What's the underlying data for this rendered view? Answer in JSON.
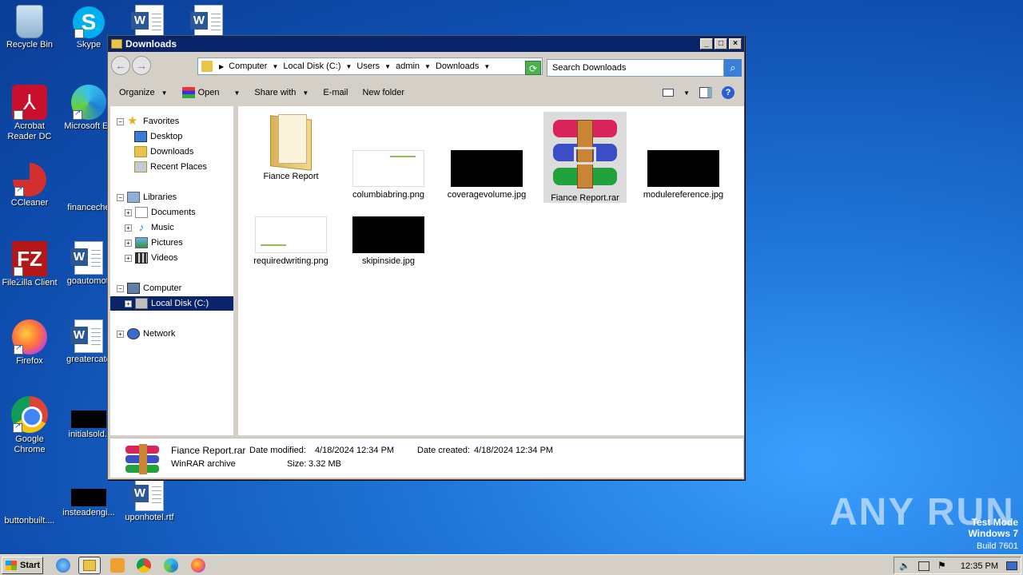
{
  "desktop": {
    "icons": [
      {
        "label": "Recycle Bin",
        "icon": "recycle-bin-icon"
      },
      {
        "label": "Skype",
        "icon": "skype-icon"
      },
      {
        "label": "Acrobat Reader DC",
        "icon": "acrobat-icon"
      },
      {
        "label": "Microsoft Ed",
        "icon": "edge-icon"
      },
      {
        "label": "CCleaner",
        "icon": "ccleaner-icon"
      },
      {
        "label": "financeche",
        "icon": "blank-file-icon"
      },
      {
        "label": "FileZilla Client",
        "icon": "filezilla-icon"
      },
      {
        "label": "goautomoti",
        "icon": "word-doc-icon"
      },
      {
        "label": "Firefox",
        "icon": "firefox-icon"
      },
      {
        "label": "greatercate",
        "icon": "word-doc-icon"
      },
      {
        "label": "Google Chrome",
        "icon": "chrome-icon"
      },
      {
        "label": "initialsold.j",
        "icon": "image-file-icon"
      },
      {
        "label": "buttonbuilt....",
        "icon": "blank-file-icon"
      },
      {
        "label": "insteadengi...",
        "icon": "image-file-icon"
      },
      {
        "label": "uponhotel.rtf",
        "icon": "word-doc-icon"
      }
    ],
    "watermark": {
      "line1": "Test Mode",
      "line2": "Windows 7",
      "line3": "Build 7601"
    },
    "brand": "ANY RUN"
  },
  "window": {
    "title": "Downloads",
    "controls": {
      "minimize": "_",
      "maximize": "□",
      "close": "×"
    },
    "nav": {
      "back": "←",
      "forward": "→"
    },
    "breadcrumb": [
      "Computer",
      "Local Disk (C:)",
      "Users",
      "admin",
      "Downloads"
    ],
    "search_placeholder": "Search Downloads",
    "toolbar": {
      "organize": "Organize",
      "open": "Open",
      "share_with": "Share with",
      "email": "E-mail",
      "new_folder": "New folder"
    },
    "nav_pane": {
      "favorites": "Favorites",
      "desktop": "Desktop",
      "downloads": "Downloads",
      "recent": "Recent Places",
      "libraries": "Libraries",
      "documents": "Documents",
      "music": "Music",
      "pictures": "Pictures",
      "videos": "Videos",
      "computer": "Computer",
      "local_disk": "Local Disk (C:)",
      "network": "Network"
    },
    "files": [
      {
        "name": "Fiance Report",
        "type": "folder"
      },
      {
        "name": "columbiabring.png",
        "type": "white-image"
      },
      {
        "name": "coveragevolume.jpg",
        "type": "black-image"
      },
      {
        "name": "Fiance Report.rar",
        "type": "rar",
        "selected": true
      },
      {
        "name": "modulereference.jpg",
        "type": "black-image"
      },
      {
        "name": "requiredwriting.png",
        "type": "white-image"
      },
      {
        "name": "skipinside.jpg",
        "type": "black-image"
      }
    ],
    "details": {
      "name": "Fiance Report.rar",
      "type": "WinRAR archive",
      "modified_label": "Date modified:",
      "modified": "4/18/2024 12:34 PM",
      "created_label": "Date created:",
      "created": "4/18/2024 12:34 PM",
      "size_label": "Size:",
      "size": "3.32 MB"
    }
  },
  "taskbar": {
    "start": "Start",
    "clock": "12:35 PM"
  }
}
